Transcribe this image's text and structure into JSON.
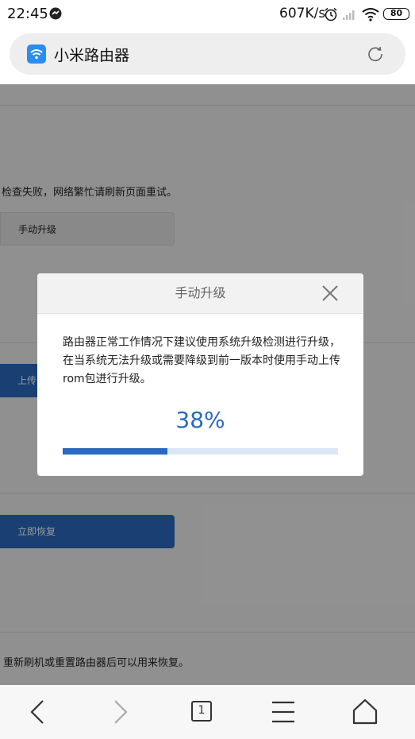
{
  "status_bar": {
    "time": "22:45",
    "net_speed": "607K/s",
    "battery": "80",
    "icons": [
      "app-notification-icon",
      "alarm-icon",
      "signal-icon",
      "wifi-icon",
      "battery-icon"
    ]
  },
  "address_bar": {
    "title": "小米路由器",
    "favicon": "wifi-icon",
    "reload_icon": "reload-icon"
  },
  "page": {
    "check_failed_text": "检查失败，网络繁忙请刷新页面重试。",
    "manual_upgrade_button": "手动升级",
    "upload_button_partial": "上传",
    "restore_button": "立即恢复",
    "restore_hint": "重新刷机或重置路由器后可以用来恢复。"
  },
  "modal": {
    "title": "手动升级",
    "description": "路由器正常工作情况下建议使用系统升级检测进行升级，在当系统无法升级或需要降级到前一版本时使用手动上传rom包进行升级。",
    "percent_text": "38%",
    "progress": 0.38
  },
  "bottom_nav": {
    "tab_count": "1",
    "items": [
      "back-icon",
      "forward-icon",
      "tabs-icon",
      "menu-icon",
      "home-icon"
    ]
  },
  "colors": {
    "accent": "#2a69c0",
    "progress_track": "#dbe7f6",
    "overlay": "rgba(0,0,0,0.4)"
  }
}
